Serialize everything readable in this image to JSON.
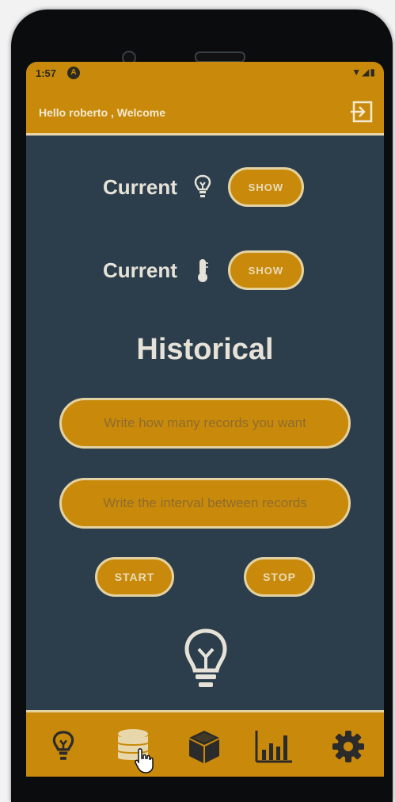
{
  "status_bar": {
    "time": "1:57",
    "notification_letter": "A",
    "icons": [
      "wifi-icon",
      "signal-icon",
      "battery-icon"
    ]
  },
  "app_bar": {
    "welcome_text": "Hello roberto , Welcome",
    "logout_icon": "logout-icon"
  },
  "current_rows": [
    {
      "label": "Current",
      "icon": "lightbulb-icon",
      "button_label": "SHOW"
    },
    {
      "label": "Current",
      "icon": "thermometer-icon",
      "button_label": "SHOW"
    }
  ],
  "historical": {
    "title": "Historical",
    "records_placeholder": "Write how many records you want",
    "interval_placeholder": "Write the interval between records",
    "start_label": "START",
    "stop_label": "STOP",
    "status_icon": "lightbulb-outline-icon"
  },
  "bottom_nav": [
    {
      "icon": "lightbulb-icon"
    },
    {
      "icon": "database-icon",
      "active": true
    },
    {
      "icon": "cube-icon"
    },
    {
      "icon": "bar-chart-icon"
    },
    {
      "icon": "gear-icon"
    }
  ],
  "colors": {
    "accent": "#c98a0b",
    "background": "#2c3e4c",
    "border": "#e4d2a2",
    "text_light": "#e6e2d8"
  }
}
